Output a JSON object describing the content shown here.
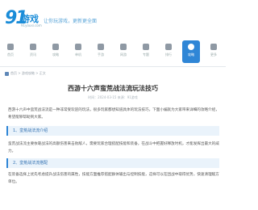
{
  "site": {
    "logo_number": "91",
    "logo_name": "游戏",
    "logo_sub": "91youxi.com",
    "slogan": "让你玩游戏，更新更全面"
  },
  "nav": {
    "items": [
      {
        "label": "首页"
      },
      {
        "label": "资讯"
      },
      {
        "label": "攻略"
      },
      {
        "label": "单机"
      },
      {
        "label": "手游"
      },
      {
        "label": "网游"
      },
      {
        "label": "专题"
      },
      {
        "label": "排行"
      },
      {
        "label": "攻略"
      },
      {
        "label": "更多"
      }
    ],
    "active_index": 8,
    "active_color": "#2f86d6"
  },
  "breadcrumb": "首页 > 游戏攻略 > 正文",
  "article": {
    "title": "西游十六声蛮荒战法流玩法技巧",
    "meta": "时间：2024-03-15  来源：91游戏",
    "intro": "西游十六声中蛮荒战法流是一种非常受欢迎的玩法，很多玩家都想知道具体的玩法技巧，下面小编就为大家带来详细的攻略介绍，希望能够帮助到大家。",
    "section1": "1、蛮荒战法流介绍",
    "body1": "蛮荒战法流主要依靠战法的高额伤害来击败敌人，需要玩家合理搭配技能和装备，在战斗中把握好释放时机，才能发挥出最大的威力。",
    "section2": "2、蛮荒战法流搭配",
    "body2": "在装备选择上优先考虑提升战法伤害的属性，技能方面推荐搭配群体输出与控制技能，这样可以在团战中取得优势，快速清理敌方单位。"
  }
}
